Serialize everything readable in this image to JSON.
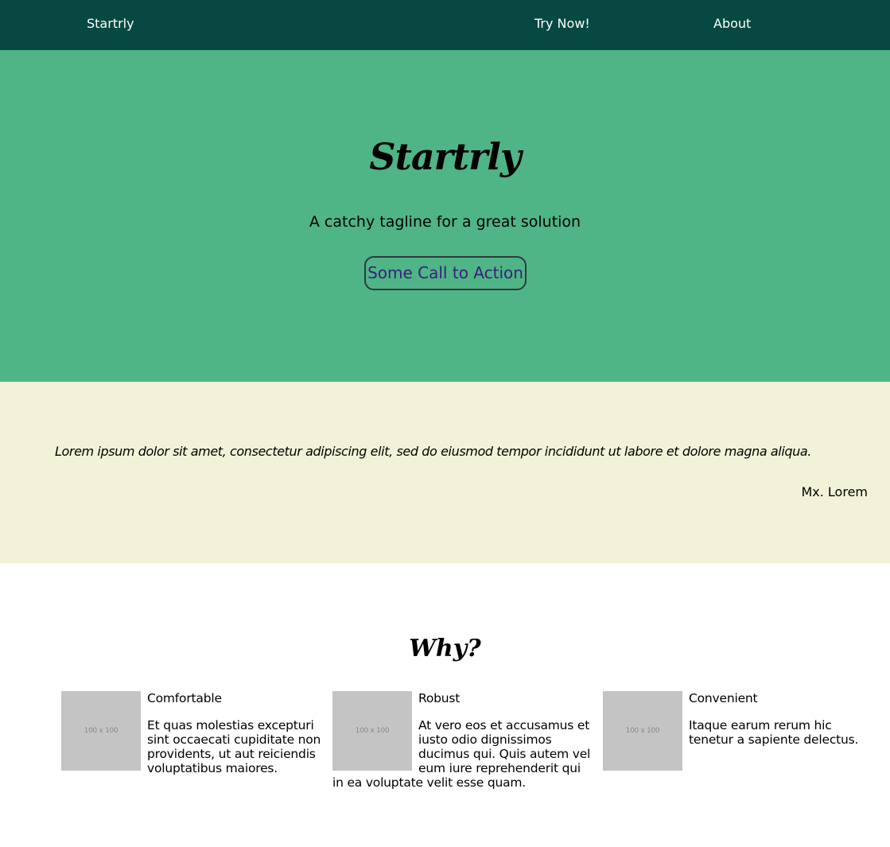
{
  "nav": {
    "brand": "Startrly",
    "try_now": "Try Now!",
    "about": "About"
  },
  "hero": {
    "title": "Startrly",
    "tagline": "A catchy tagline for a great solution",
    "cta_label": "Some Call to Action"
  },
  "testimonial": {
    "quote": "Lorem ipsum dolor sit amet, consectetur adipiscing elit, sed do eiusmod tempor incididunt ut labore et dolore magna aliqua.",
    "author": "Mx. Lorem"
  },
  "why": {
    "heading": "Why?",
    "features": [
      {
        "thumb_label": "100 x 100",
        "title": "Comfortable",
        "text": "Et quas molestias excepturi sint occaecati cupiditate non providents, ut aut reiciendis voluptatibus maiores."
      },
      {
        "thumb_label": "100 x 100",
        "title": "Robust",
        "text": "At vero eos et accusamus et iusto odio dignissimos ducimus qui. Quis autem vel eum iure reprehenderit qui in ea voluptate velit esse quam."
      },
      {
        "thumb_label": "100 x 100",
        "title": "Convenient",
        "text": "Itaque earum rerum hic tenetur a sapiente delectus."
      }
    ]
  },
  "colors": {
    "nav_bg": "#054942",
    "hero_bg": "#4fb486",
    "quote_bg": "#f2f2d9",
    "cta_text": "#3b1f7a",
    "thumb_bg": "#c4c4c4"
  }
}
